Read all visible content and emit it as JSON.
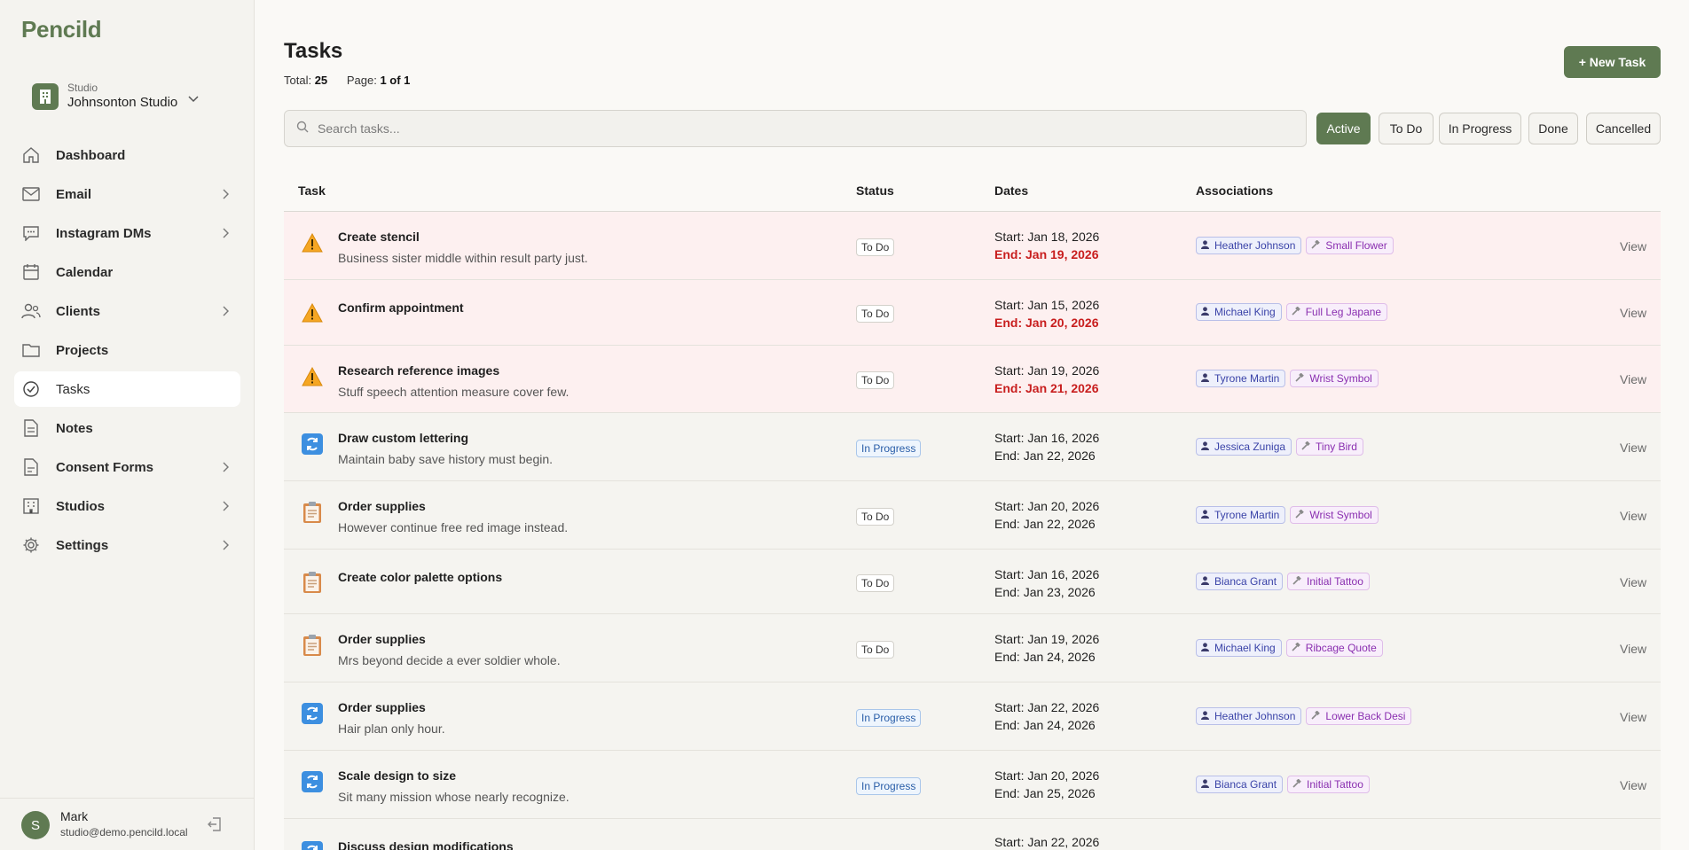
{
  "app": {
    "name": "Pencild"
  },
  "studio": {
    "label": "Studio",
    "name": "Johnsonton Studio"
  },
  "nav": [
    {
      "label": "Dashboard",
      "icon": "home-icon",
      "chevron": false,
      "active": false
    },
    {
      "label": "Email",
      "icon": "mail-icon",
      "chevron": true,
      "active": false
    },
    {
      "label": "Instagram DMs",
      "icon": "chat-icon",
      "chevron": true,
      "active": false
    },
    {
      "label": "Calendar",
      "icon": "calendar-icon",
      "chevron": false,
      "active": false
    },
    {
      "label": "Clients",
      "icon": "users-icon",
      "chevron": true,
      "active": false
    },
    {
      "label": "Projects",
      "icon": "folder-icon",
      "chevron": false,
      "active": false
    },
    {
      "label": "Tasks",
      "icon": "check-circle-icon",
      "chevron": false,
      "active": true
    },
    {
      "label": "Notes",
      "icon": "document-icon",
      "chevron": false,
      "active": false
    },
    {
      "label": "Consent Forms",
      "icon": "form-icon",
      "chevron": true,
      "active": false
    },
    {
      "label": "Studios",
      "icon": "building-icon",
      "chevron": true,
      "active": false
    },
    {
      "label": "Settings",
      "icon": "gear-icon",
      "chevron": true,
      "active": false
    }
  ],
  "user": {
    "initial": "S",
    "name": "Mark",
    "email": "studio@demo.pencild.local"
  },
  "page": {
    "title": "Tasks",
    "total_label": "Total:",
    "total": "25",
    "page_label": "Page:",
    "page": "1 of 1",
    "new_button": "+  New Task"
  },
  "search": {
    "placeholder": "Search tasks..."
  },
  "filters": [
    {
      "label": "Active",
      "active": true
    },
    {
      "label": "To Do",
      "active": false
    },
    {
      "label": "In Progress",
      "active": false
    },
    {
      "label": "Done",
      "active": false
    },
    {
      "label": "Cancelled",
      "active": false
    }
  ],
  "table": {
    "headers": {
      "task": "Task",
      "status": "Status",
      "dates": "Dates",
      "associations": "Associations"
    },
    "view_label": "View",
    "rows": [
      {
        "icon": "warning-icon",
        "title": "Create stencil",
        "desc": "Business sister middle within result party just.",
        "status": "To Do",
        "start": "Start: Jan 18, 2026",
        "end": "End: Jan 19, 2026",
        "overdue": true,
        "client": "Heather Johnson",
        "project": "Small Flower"
      },
      {
        "icon": "warning-icon",
        "title": "Confirm appointment",
        "desc": "",
        "status": "To Do",
        "start": "Start: Jan 15, 2026",
        "end": "End: Jan 20, 2026",
        "overdue": true,
        "client": "Michael King",
        "project": "Full Leg Japane"
      },
      {
        "icon": "warning-icon",
        "title": "Research reference images",
        "desc": "Stuff speech attention measure cover few.",
        "status": "To Do",
        "start": "Start: Jan 19, 2026",
        "end": "End: Jan 21, 2026",
        "overdue": true,
        "client": "Tyrone Martin",
        "project": "Wrist Symbol"
      },
      {
        "icon": "refresh-icon",
        "title": "Draw custom lettering",
        "desc": "Maintain baby save history must begin.",
        "status": "In Progress",
        "start": "Start: Jan 16, 2026",
        "end": "End: Jan 22, 2026",
        "overdue": false,
        "client": "Jessica Zuniga",
        "project": "Tiny Bird"
      },
      {
        "icon": "clipboard-icon",
        "title": "Order supplies",
        "desc": "However continue free red image instead.",
        "status": "To Do",
        "start": "Start: Jan 20, 2026",
        "end": "End: Jan 22, 2026",
        "overdue": false,
        "client": "Tyrone Martin",
        "project": "Wrist Symbol"
      },
      {
        "icon": "clipboard-icon",
        "title": "Create color palette options",
        "desc": "",
        "status": "To Do",
        "start": "Start: Jan 16, 2026",
        "end": "End: Jan 23, 2026",
        "overdue": false,
        "client": "Bianca Grant",
        "project": "Initial Tattoo"
      },
      {
        "icon": "clipboard-icon",
        "title": "Order supplies",
        "desc": "Mrs beyond decide a ever soldier whole.",
        "status": "To Do",
        "start": "Start: Jan 19, 2026",
        "end": "End: Jan 24, 2026",
        "overdue": false,
        "client": "Michael King",
        "project": "Ribcage Quote"
      },
      {
        "icon": "refresh-icon",
        "title": "Order supplies",
        "desc": "Hair plan only hour.",
        "status": "In Progress",
        "start": "Start: Jan 22, 2026",
        "end": "End: Jan 24, 2026",
        "overdue": false,
        "client": "Heather Johnson",
        "project": "Lower Back Desi"
      },
      {
        "icon": "refresh-icon",
        "title": "Scale design to size",
        "desc": "Sit many mission whose nearly recognize.",
        "status": "In Progress",
        "start": "Start: Jan 20, 2026",
        "end": "End: Jan 25, 2026",
        "overdue": false,
        "client": "Bianca Grant",
        "project": "Initial Tattoo"
      },
      {
        "icon": "refresh-icon",
        "title": "Discuss design modifications",
        "desc": "",
        "status": "",
        "start": "Start: Jan 22, 2026",
        "end": "",
        "overdue": false,
        "client": "",
        "project": ""
      }
    ]
  },
  "colors": {
    "accent": "#5f7a52",
    "overdue_bg": "#fdf0f0",
    "late_text": "#c81e1e",
    "row_bg": "#f5f4f0"
  }
}
